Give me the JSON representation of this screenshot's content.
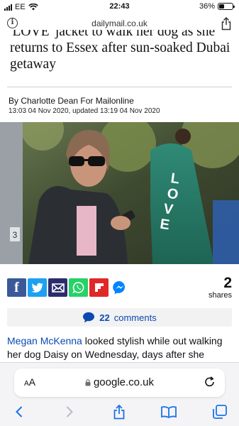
{
  "status_bar": {
    "carrier": "EE",
    "time": "22:43",
    "battery": "36%",
    "battery_level": 0.36
  },
  "url_bar": {
    "domain": "dailymail.co.uk",
    "info_icon": "info-icon",
    "share_icon": "share-icon"
  },
  "article": {
    "headline": "'LOVE' jacket to walk her dog as she returns to Essex after sun-soaked Dubai getaway",
    "byline": "By Charlotte Dean For Mailonline",
    "dateline": "13:03 04 Nov 2020, updated 13:19 04 Nov 2020",
    "photo_text": "LOVE",
    "photo_badge": "3"
  },
  "share": {
    "buttons": [
      {
        "name": "facebook-share-button",
        "icon": "facebook-icon",
        "glyph": "f",
        "color": "#3b5998"
      },
      {
        "name": "twitter-share-button",
        "icon": "twitter-icon",
        "glyph": "t",
        "color": "#1da1f2"
      },
      {
        "name": "email-share-button",
        "icon": "mail-icon",
        "glyph": "",
        "color": "#2c2c6c"
      },
      {
        "name": "whatsapp-share-button",
        "icon": "whatsapp-icon",
        "glyph": "",
        "color": "#25d366"
      },
      {
        "name": "flipboard-share-button",
        "icon": "flipboard-icon",
        "glyph": "",
        "color": "#e12828"
      },
      {
        "name": "messenger-share-button",
        "icon": "messenger-icon",
        "glyph": "",
        "color": "#0084ff"
      }
    ],
    "count": "2",
    "count_label": "shares"
  },
  "comments": {
    "count": "22",
    "label": "comments",
    "color": "#0a49b3"
  },
  "body": {
    "link_text": "Megan McKenna",
    "text": " looked stylish while out walking her dog Daisy on Wednesday, days after she returned to Essex following her holiday to Dubai."
  },
  "safari": {
    "text_size_label": "AA",
    "host": "google.co.uk",
    "toolbar": [
      "back-icon",
      "forward-icon",
      "share-icon",
      "bookmarks-icon",
      "tabs-icon"
    ]
  }
}
